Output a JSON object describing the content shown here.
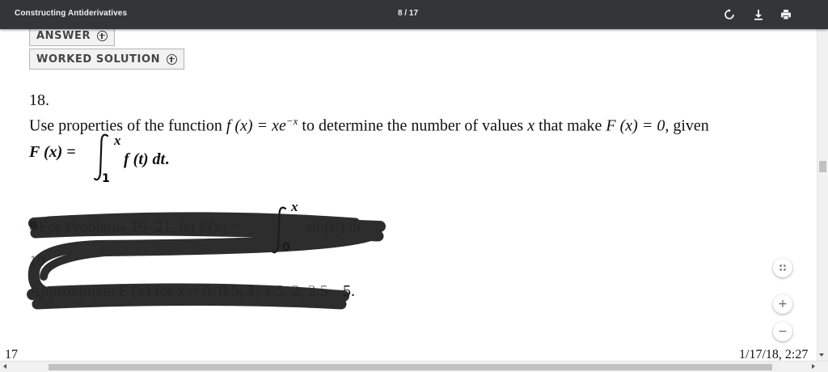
{
  "toolbar": {
    "title": "Constructing Antiderivatives",
    "page_current": "8",
    "page_separator": "/",
    "page_total": "17",
    "icons": [
      "rotate-icon",
      "download-icon",
      "print-icon"
    ]
  },
  "buttons": {
    "answer": "ANSWER",
    "worked_solution": "WORKED SOLUTION"
  },
  "problem18": {
    "number": "18.",
    "text_1": "Use properties of the function ",
    "f_expr": "f (x) = xe",
    "exponent": "−x",
    "text_2": " to determine the number of values ",
    "var_x": "x",
    "text_3": " that make ",
    "F_expr": "F (x) = 0",
    "text_4": ", given",
    "definition_lhs": "F (x) =",
    "upper_limit": "x",
    "lower_limit": "1",
    "integrand": "f (t)  dt",
    "period": "."
  },
  "problem19_header": {
    "text": "For Problems 19–21, let F(x) =",
    "upper_limit": "x",
    "lower_limit": "0",
    "integrand": "sin(t²) dt",
    "period": "."
  },
  "problem19": {
    "number": "19.",
    "text": "Approximate F (x) for x = 0, 0.5, 1, 1.5, 2, 2.5",
    "tail": "5."
  },
  "side_controls": [
    "fit-page-icon",
    "+",
    "−"
  ],
  "footer": {
    "left_number": "17",
    "timestamp": "1/17/18, 2:27"
  },
  "colors": {
    "toolbar_bg": "#323639",
    "toolbar_text": "#f1f1f1",
    "scribble": "#222222"
  }
}
